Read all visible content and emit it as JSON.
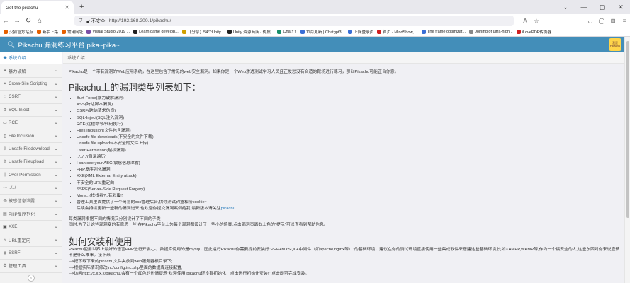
{
  "browser": {
    "tab_title": "Get the pikachu",
    "tab_close": "✕",
    "new_tab": "+",
    "insecure_label": "不安全",
    "url": "http://192.168.200.1/pikachu/",
    "bookmarks": [
      {
        "label": "火狐官方站点",
        "color": "#e66000"
      },
      {
        "label": "新手上路",
        "color": "#e66000"
      },
      {
        "label": "常用网址",
        "color": "#e66000"
      },
      {
        "label": "Visual Studio 2019 ...",
        "color": "#7b4fa6"
      },
      {
        "label": "Learn game develop...",
        "color": "#222222"
      },
      {
        "label": "【分享】54个Unity...",
        "color": "#d0a000"
      },
      {
        "label": "Unity 资源商店 - 优质...",
        "color": "#222222"
      },
      {
        "label": "ChatYY",
        "color": "#1a8f6a"
      },
      {
        "label": "11月更新 | Chatgpt3...",
        "color": "#3b6fd6"
      },
      {
        "label": "上网登录页",
        "color": "#3b6fd6"
      },
      {
        "label": "首页 - MindShow, ...",
        "color": "#d02020"
      },
      {
        "label": "The frame optimizat...",
        "color": "#3b6fd6"
      },
      {
        "label": "Joining of ultra-high...",
        "color": "#888888"
      },
      {
        "label": "iLovePDF转换器",
        "color": "#d02020"
      }
    ]
  },
  "app": {
    "title": "Pikachu 漏洞练习平台 pika~pika~",
    "avatar_text": "我是 Pikachu"
  },
  "sidebar": {
    "items": [
      {
        "label": "系统介绍",
        "icon": "◉",
        "active": true,
        "chev": ""
      },
      {
        "label": "暴力破解",
        "icon": "▪",
        "active": false,
        "chev": "⌄"
      },
      {
        "label": "Cross-Site Scripting",
        "icon": "✕",
        "active": false,
        "chev": "⌄"
      },
      {
        "label": "CSRF",
        "icon": "◌",
        "active": false,
        "chev": "⌄"
      },
      {
        "label": "SQL-Inject",
        "icon": "⊞",
        "active": false,
        "chev": "⌄"
      },
      {
        "label": "RCE",
        "icon": "▭",
        "active": false,
        "chev": "⌄"
      },
      {
        "label": "File Inclusion",
        "icon": "▯",
        "active": false,
        "chev": "⌄"
      },
      {
        "label": "Unsafe Filedownload",
        "icon": "⇩",
        "active": false,
        "chev": "⌄"
      },
      {
        "label": "Unsafe Fileupload",
        "icon": "⇧",
        "active": false,
        "chev": "⌄"
      },
      {
        "label": "Over Permission",
        "icon": "|",
        "active": false,
        "chev": "⌄"
      },
      {
        "label": "../../",
        "icon": "⋯",
        "active": false,
        "chev": "⌄"
      },
      {
        "label": "敏感信息泄露",
        "icon": "◍",
        "active": false,
        "chev": "⌄"
      },
      {
        "label": "PHP反序列化",
        "icon": "▤",
        "active": false,
        "chev": "⌄"
      },
      {
        "label": "XXE",
        "icon": "▣",
        "active": false,
        "chev": "⌄"
      },
      {
        "label": "URL重定向",
        "icon": "⤷",
        "active": false,
        "chev": "⌄"
      },
      {
        "label": "SSRF",
        "icon": "◈",
        "active": false,
        "chev": "⌄"
      },
      {
        "label": "管理工具",
        "icon": "⚙",
        "active": false,
        "chev": "⌄"
      }
    ],
    "collapse": "«"
  },
  "breadcrumb": "系统介绍",
  "content": {
    "intro": "Pikachu是一个带有漏洞的Web应用系统，在这里包含了常见的web安全漏洞。如果你是一个Web渗透测试学习人员且正发愁没有合适的靶场进行练习，那么Pikachu可能正合你意。",
    "heading1": "Pikachu上的漏洞类型列表如下：",
    "vulns": [
      "Burt Force(暴力破解漏洞)",
      "XSS(跨站脚本漏洞)",
      "CSRF(跨站请求伪造)",
      "SQL-Inject(SQL注入漏洞)",
      "RCE(远程命令/代码执行)",
      "Files Inclusion(文件包含漏洞)",
      "Unsafe file downloads(不安全的文件下载)",
      "Unsafe file uploads(不安全的文件上传)",
      "Over Permisson(越权漏洞)",
      "../../../(目录遍历)",
      "I can see your ABC(敏感信息泄露)",
      "PHP反序列化漏洞",
      "XXE(XML External Entity attack)",
      "不安全的URL重定向",
      "SSRF(Server-Side Request Forgery)",
      "More...(找找看?..有彩蛋!)",
      "管理工具里面提供了一个简易的xss管理后台,供你测试钓鱼和捞cookie~"
    ],
    "last_vuln_text": "后续会持续更新一些新的漏洞进来,也欢迎你提交漏洞案例给我,最新版本请关注",
    "last_vuln_link": "pikachu",
    "para1": "每类漏洞根据不同的情况又分别设计了不同的子类",
    "para2": "同时,为了让这些漏洞变的有意思一些,在Pikachu平台上为每个漏洞都设计了一些小的场景,点击漏洞页面右上角的\"提示\"可以查看到帮助信息。",
    "heading2": "如何安装和使用",
    "install": [
      "Pikachu使用世界上最好的语言PHP进行开发-_-，数据库使用的是mysql，因此运行Pikachu你需要提前安装好\"PHP+MYSQL+中间件（如apache,nginx等）\"的基础环境，建议在你的测试环境直接使用一些集成软件来搭建这些基础环境,比如XAMPP,WAMP等,作为一个搞安全的人,这些东西对你来说应该不是什么难事。接下来:",
      "-->把下载下来的pikachu文件夹放到web服务器根目录下;",
      "-->根据实际情况修改inc/config.inc.php里面的数据库连接配置;",
      "-->访问http://x.x.x.x/pikachu,会有一个红色的热情提示\"欢迎使用,pikachu还没有初始化，点击进行初始化安装!\",点击即可完成安装。"
    ]
  }
}
